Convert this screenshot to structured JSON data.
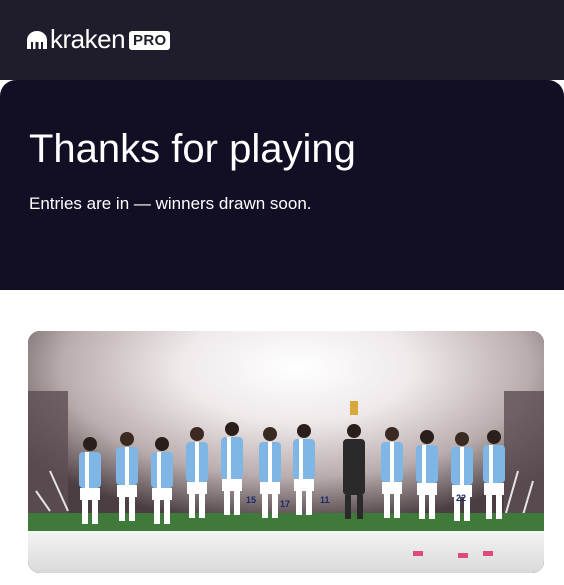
{
  "header": {
    "brand_word": "kraken",
    "brand_badge": "PRO",
    "logo_icon": "kraken-logo-icon"
  },
  "hero": {
    "title": "Thanks for playing",
    "subtitle": "Entries are in — winners drawn soon."
  },
  "photo": {
    "subject": "celebration-team-photo",
    "jersey_numbers": [
      "15",
      "17",
      "11",
      "22"
    ]
  },
  "colors": {
    "topbar": "#1f1d2b",
    "hero": "#120f24",
    "text_light": "#ffffff",
    "jersey_blue": "#7fb6e6"
  }
}
